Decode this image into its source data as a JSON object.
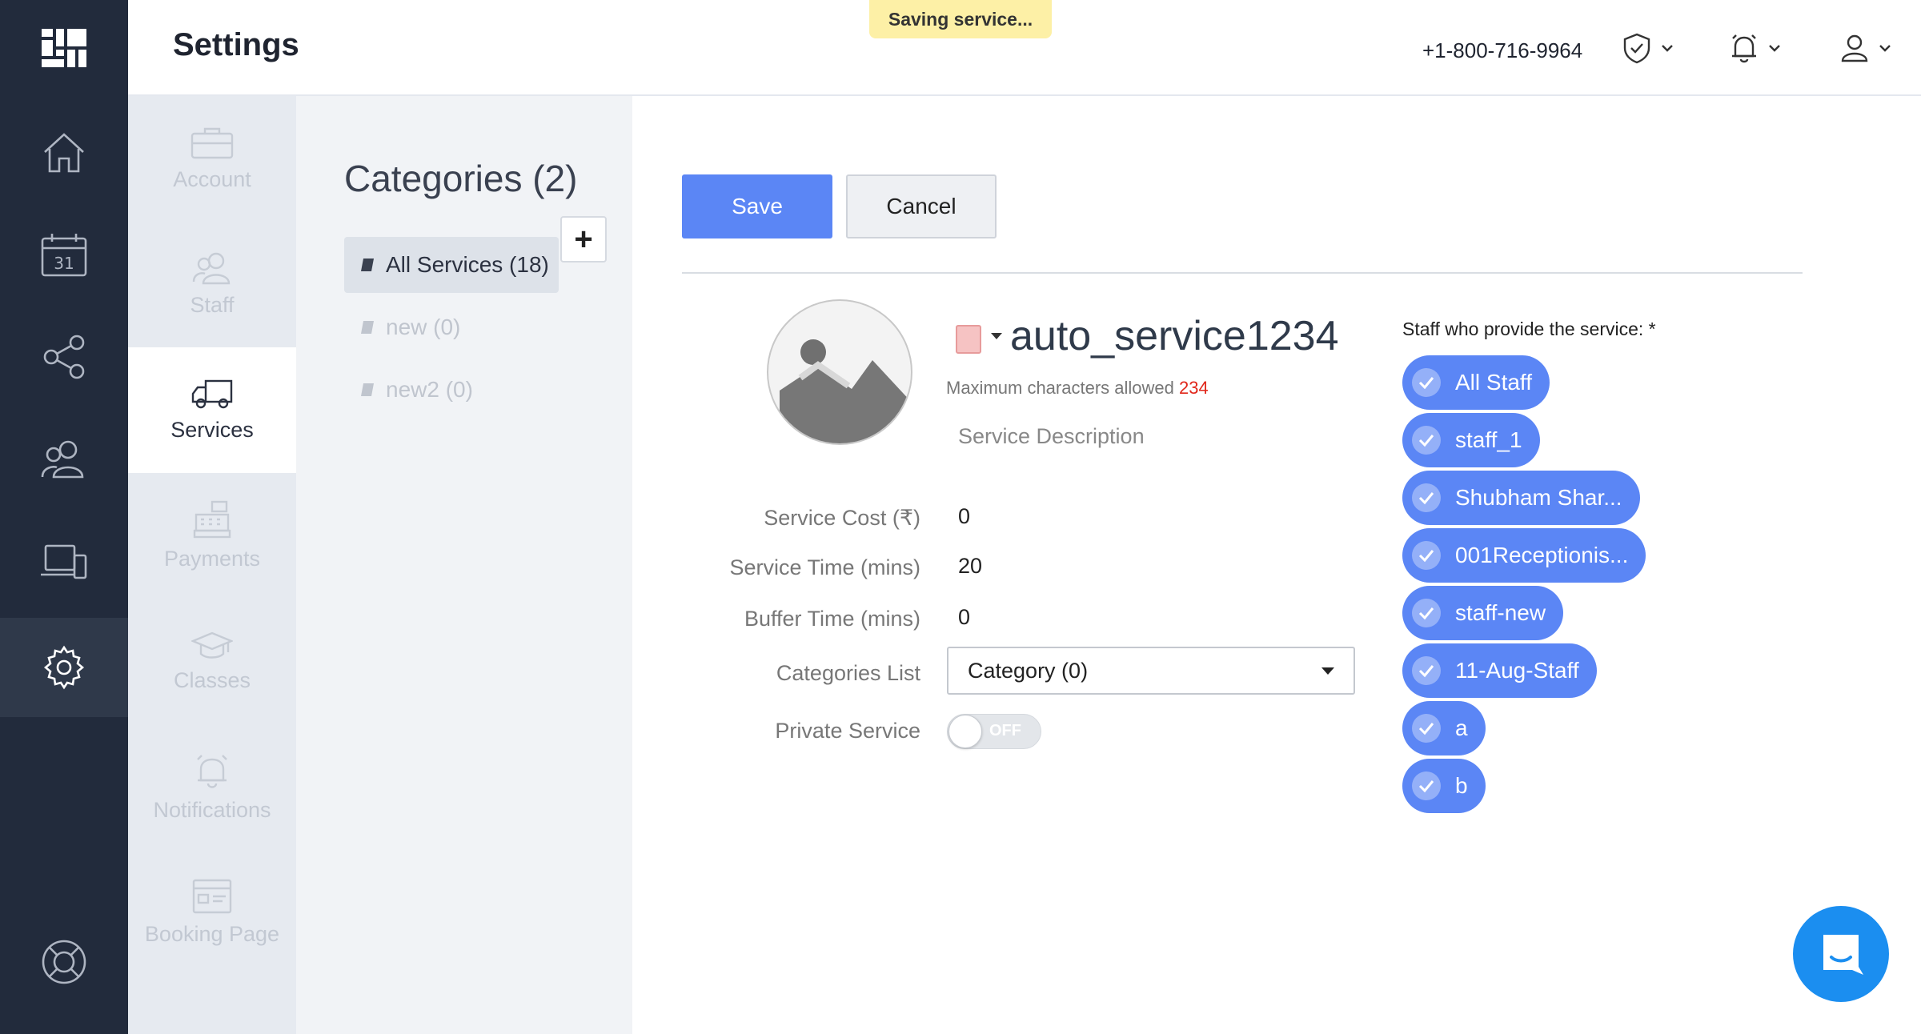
{
  "app": {
    "title": "Settings",
    "phone": "+1-800-716-9964",
    "toast": "Saving service..."
  },
  "rail": {
    "items": [
      "logo-icon",
      "home-icon",
      "calendar-icon",
      "share-icon",
      "customers-icon",
      "devices-icon",
      "gear-icon",
      "help-icon"
    ],
    "calendar_day": "31",
    "active": "gear-icon"
  },
  "subnav": {
    "items": [
      {
        "label": "Account",
        "icon": "briefcase-icon"
      },
      {
        "label": "Staff",
        "icon": "staff-icon"
      },
      {
        "label": "Services",
        "icon": "truck-icon"
      },
      {
        "label": "Payments",
        "icon": "register-icon"
      },
      {
        "label": "Classes",
        "icon": "graduation-cap-icon"
      },
      {
        "label": "Notifications",
        "icon": "bell-icon"
      },
      {
        "label": "Booking Page",
        "icon": "browser-icon"
      }
    ],
    "active": "Services"
  },
  "categories": {
    "heading": "Categories (2)",
    "add_label": "+",
    "items": [
      {
        "label": "All Services (18)"
      },
      {
        "label": "new (0)"
      },
      {
        "label": "new2 (0)"
      }
    ]
  },
  "form": {
    "save_label": "Save",
    "cancel_label": "Cancel",
    "service_name": "auto_service1234",
    "max_chars_label": "Maximum characters allowed",
    "max_chars_value": "234",
    "description_placeholder": "Service Description",
    "fields": [
      {
        "label": "Service Cost (₹)",
        "value": "0"
      },
      {
        "label": "Service Time (mins)",
        "value": "20"
      },
      {
        "label": "Buffer Time (mins)",
        "value": "0"
      }
    ],
    "categories_label": "Categories List",
    "categories_selected": "Category (0)",
    "private_label": "Private Service",
    "private_toggle": "OFF",
    "swatch_color": "#f6c3c3"
  },
  "staff": {
    "title": "Staff who provide the service: *",
    "chips": [
      "All Staff",
      "staff_1",
      "Shubham Shar...",
      "001Receptionis...",
      "staff-new",
      "11-Aug-Staff",
      "a",
      "b"
    ]
  },
  "colors": {
    "primary": "#5b86f5",
    "rail_bg": "#222b3c",
    "toast_bg": "#fdf0a6",
    "chat": "#1b8ef0"
  }
}
